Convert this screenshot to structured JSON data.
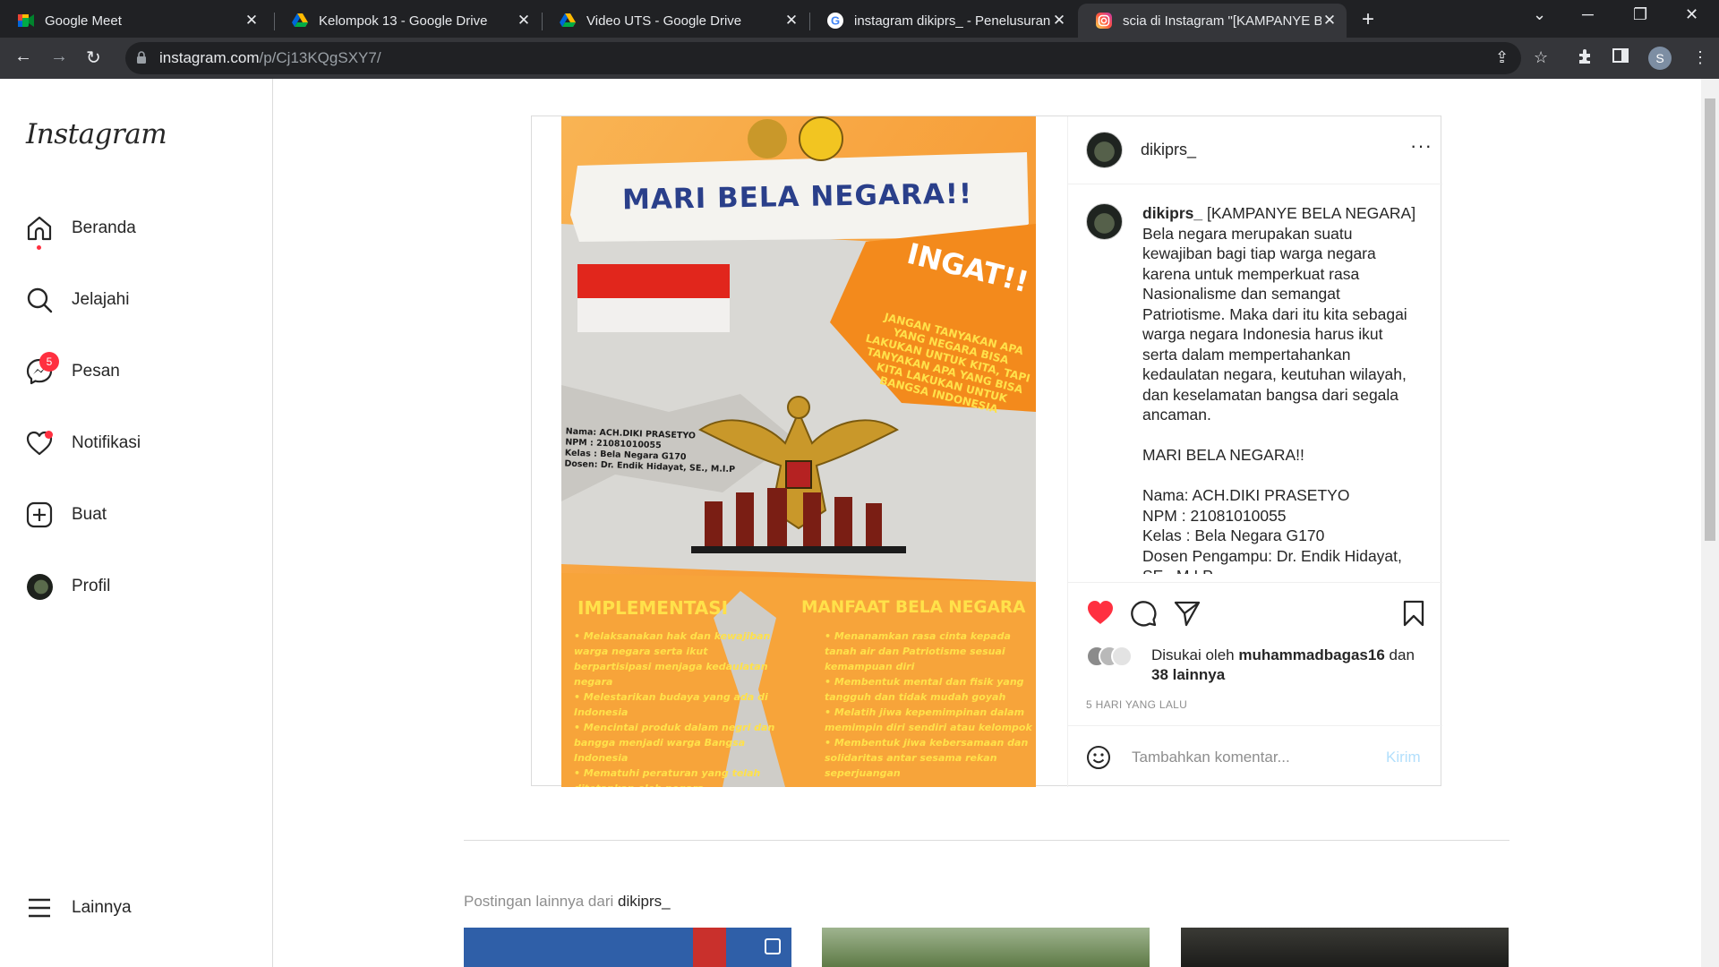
{
  "browser": {
    "tabs": [
      {
        "title": "Google Meet",
        "icon": "google-meet-icon"
      },
      {
        "title": "Kelompok 13 - Google Drive",
        "icon": "google-drive-icon"
      },
      {
        "title": "Video UTS - Google Drive",
        "icon": "google-drive-icon"
      },
      {
        "title": "instagram dikiprs_ - Penelusuran",
        "icon": "google-icon"
      },
      {
        "title": "scia di Instagram \"[KAMPANYE BELA",
        "icon": "instagram-icon",
        "active": true
      }
    ],
    "url_host": "instagram.com",
    "url_path": "/p/Cj13KQgSXY7/",
    "profile_initial": "S"
  },
  "sidebar": {
    "logo": "Instagram",
    "items": [
      {
        "label": "Beranda",
        "icon": "home-icon"
      },
      {
        "label": "Jelajahi",
        "icon": "search-icon"
      },
      {
        "label": "Pesan",
        "icon": "messenger-icon",
        "badge": "5"
      },
      {
        "label": "Notifikasi",
        "icon": "heart-icon"
      },
      {
        "label": "Buat",
        "icon": "plus-square-icon"
      },
      {
        "label": "Profil",
        "icon": "avatar-icon"
      }
    ],
    "more_label": "Lainnya"
  },
  "post": {
    "image": {
      "title": "MARI BELA NEGARA!!",
      "ingat_title": "INGAT!!",
      "ingat_text": "JANGAN TANYAKAN APA YANG NEGARA BISA LAKUKAN UNTUK KITA, TAPI TANYAKAN APA YANG BISA KITA LAKUKAN UNTUK BANGSA INDONESIA",
      "id_lines": [
        "Nama: ACH.DIKI PRASETYO",
        "NPM : 21081010055",
        "Kelas : Bela Negara G170",
        "Dosen: Dr. Endik Hidayat, SE., M.I.P"
      ],
      "implementasi_title": "IMPLEMENTASI",
      "implementasi_items": [
        "Melaksanakan hak dan kewajiban warga negara serta ikut berpartisipasi menjaga kedaulatan negara",
        "Melestarikan budaya yang ada di Indonesia",
        "Mencintai produk dalam negri dan bangga menjadi warga Bangsa Indonesia",
        "Mematuhi peraturan yang telah ditetapkan oleh negara"
      ],
      "manfaat_title": "MANFAAT BELA NEGARA",
      "manfaat_items": [
        "Menanamkan rasa cinta kepada tanah air dan Patriotisme sesuai kemampuan diri",
        "Membentuk mental dan fisik yang tangguh dan tidak mudah goyah",
        "Melatih jiwa kepemimpinan dalam memimpin diri sendiri atau kelompok",
        "Membentuk jiwa kebersamaan dan solidaritas antar sesama rekan seperjuangan"
      ]
    },
    "username": "dikiprs_",
    "caption_lines": [
      "[KAMPANYE BELA NEGARA]",
      "Bela negara merupakan suatu kewajiban bagi tiap warga negara karena untuk memperkuat rasa Nasionalisme dan semangat Patriotisme. Maka dari itu kita sebagai warga negara Indonesia harus ikut serta dalam mempertahankan kedaulatan negara, keutuhan wilayah, dan keselamatan bangsa dari segala ancaman.",
      "MARI BELA NEGARA!!",
      "Nama: ACH.DIKI PRASETYO",
      "NPM : 21081010055",
      "Kelas : Bela Negara G170",
      "Dosen Pengampu: Dr. Endik Hidayat, SE., M.I.P"
    ],
    "likes_prefix": "Disukai oleh",
    "likes_user": "muhammadbagas16",
    "likes_and": "dan",
    "likes_others": "38 lainnya",
    "time_ago": "5 HARI YANG LALU",
    "comment_placeholder": "Tambahkan komentar...",
    "send_label": "Kirim",
    "liked_color": "#ff3040"
  },
  "more_posts": {
    "prefix": "Postingan lainnya dari",
    "username": "dikiprs_"
  }
}
